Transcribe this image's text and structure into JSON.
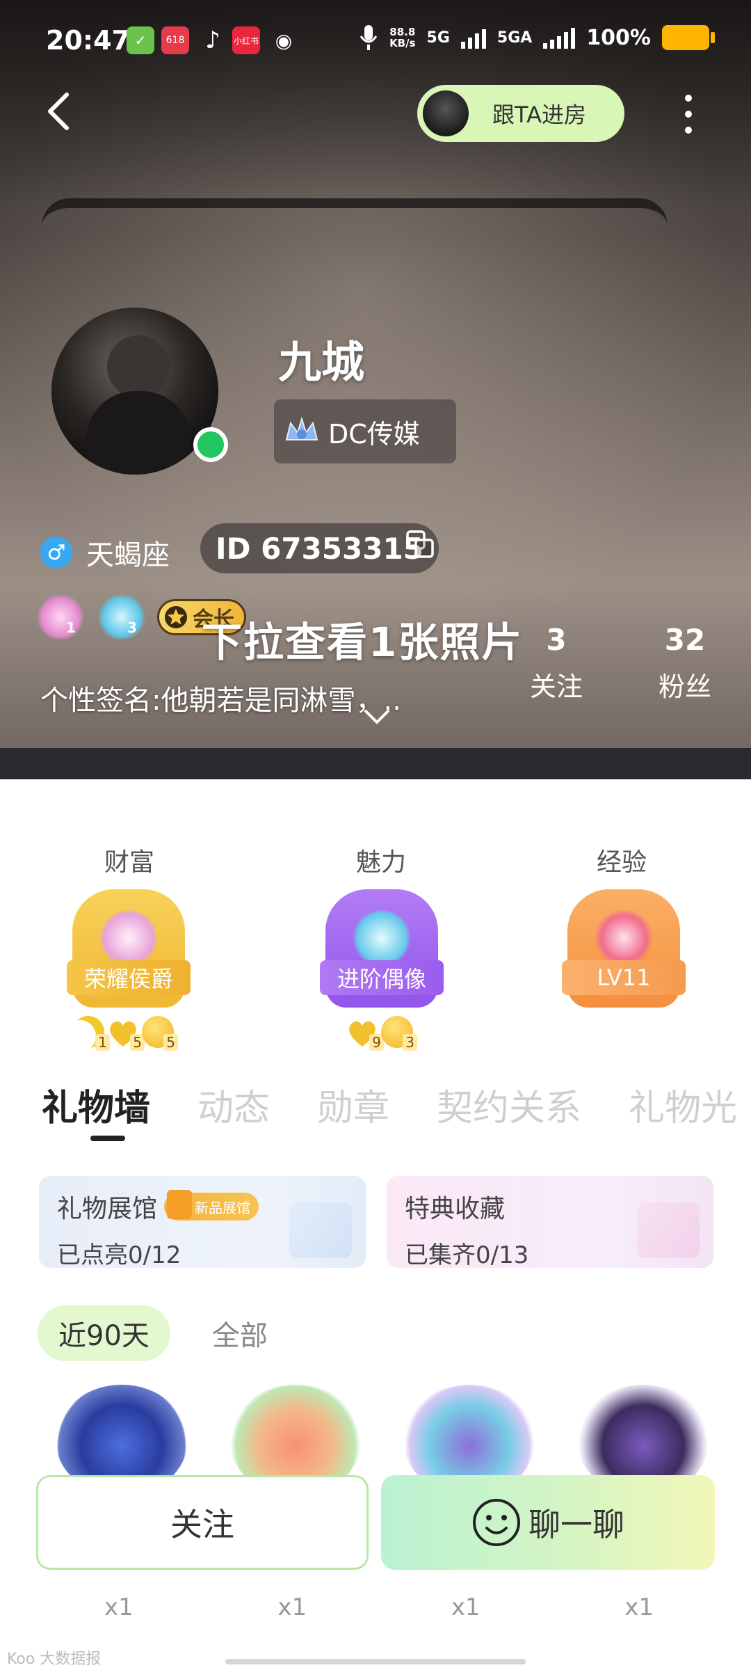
{
  "status": {
    "time": "20:47",
    "speed_value": "88.8",
    "speed_unit": "KB/s",
    "net1": "5G",
    "net2": "5GA",
    "battery": "100%",
    "app_icons": [
      "calendar-check-icon",
      "app-618-icon",
      "tiktok-icon",
      "xiaohongshu-icon",
      "weibo-icon"
    ]
  },
  "header": {
    "follow_room_label": "跟TA进房"
  },
  "profile": {
    "name": "九城",
    "org": "DC传媒",
    "zodiac": "天蝎座",
    "id_label": "ID 67353315",
    "president_label": "会长",
    "badge_levels": [
      "1",
      "3"
    ],
    "photo_hint": "下拉查看1张照片",
    "following_count": "3",
    "following_label": "关注",
    "fans_count": "32",
    "fans_label": "粉丝",
    "signature": "个性签名:他朝若是同淋雪，.."
  },
  "levels": [
    {
      "title": "财富",
      "ribbon": "荣耀侯爵",
      "level": "1",
      "color": "#f4c23f",
      "ribbon_color": "#f2b535",
      "items": [
        {
          "type": "moon",
          "count": "1"
        },
        {
          "type": "heart",
          "count": "5"
        },
        {
          "type": "coin",
          "count": "5"
        }
      ]
    },
    {
      "title": "魅力",
      "ribbon": "进阶偶像",
      "level": "3",
      "color": "#a36af0",
      "ribbon_color": "#a05ef0",
      "items": [
        {
          "type": "heart",
          "count": "9"
        },
        {
          "type": "coin",
          "count": "3"
        }
      ]
    },
    {
      "title": "经验",
      "ribbon": "LV11",
      "level": "",
      "color": "#f7a050",
      "ribbon_color": "#f5a45e",
      "items": []
    }
  ],
  "tabs": [
    "礼物墙",
    "动态",
    "勋章",
    "契约关系",
    "礼物光"
  ],
  "cards": [
    {
      "title": "礼物展馆",
      "tag": "新品展馆",
      "subtitle": "已点亮0/12"
    },
    {
      "title": "特典收藏",
      "subtitle": "已集齐0/13"
    }
  ],
  "range": {
    "active": "近90天",
    "other": "全部"
  },
  "gifts": [
    "whale-gift-icon",
    "girl-gift-icon",
    "idol-gift-icon",
    "potion-gift-icon"
  ],
  "gift_counts": [
    "x1",
    "x1",
    "x1",
    "x1"
  ],
  "actions": {
    "follow": "关注",
    "chat": "聊一聊"
  },
  "watermark": "Koo 大数据报"
}
